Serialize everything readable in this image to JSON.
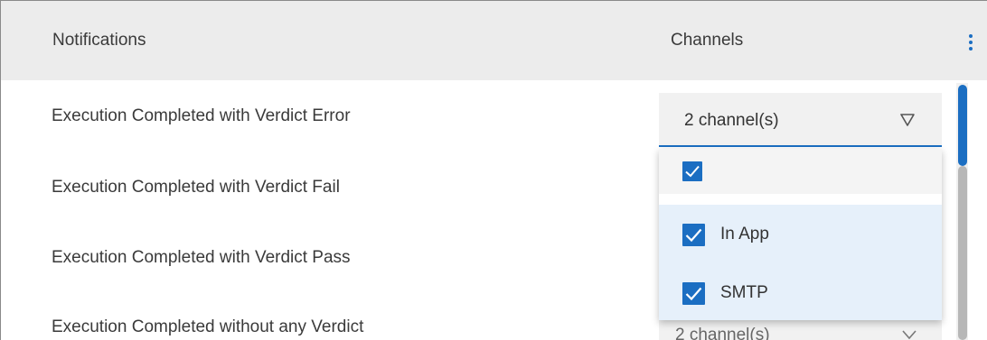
{
  "header": {
    "notifications_label": "Notifications",
    "channels_label": "Channels",
    "more_icon": "kebab-vertical-icon"
  },
  "rows": [
    {
      "label": "Execution Completed with Verdict Error"
    },
    {
      "label": "Execution Completed with Verdict Fail"
    },
    {
      "label": "Execution Completed with Verdict Pass"
    },
    {
      "label": "Execution Completed without any Verdict"
    }
  ],
  "channel_select": {
    "value": "2 channel(s)",
    "caret_icon": "triangle-down-icon"
  },
  "next_select": {
    "value": "2 channel(s)"
  },
  "dropdown": {
    "select_all_checked": true,
    "options": [
      {
        "label": "In App",
        "checked": true
      },
      {
        "label": "SMTP",
        "checked": true
      }
    ]
  },
  "colors": {
    "accent": "#1b6ec2",
    "header_bg": "#ececec",
    "option_selected_bg": "#e6f0fa"
  }
}
